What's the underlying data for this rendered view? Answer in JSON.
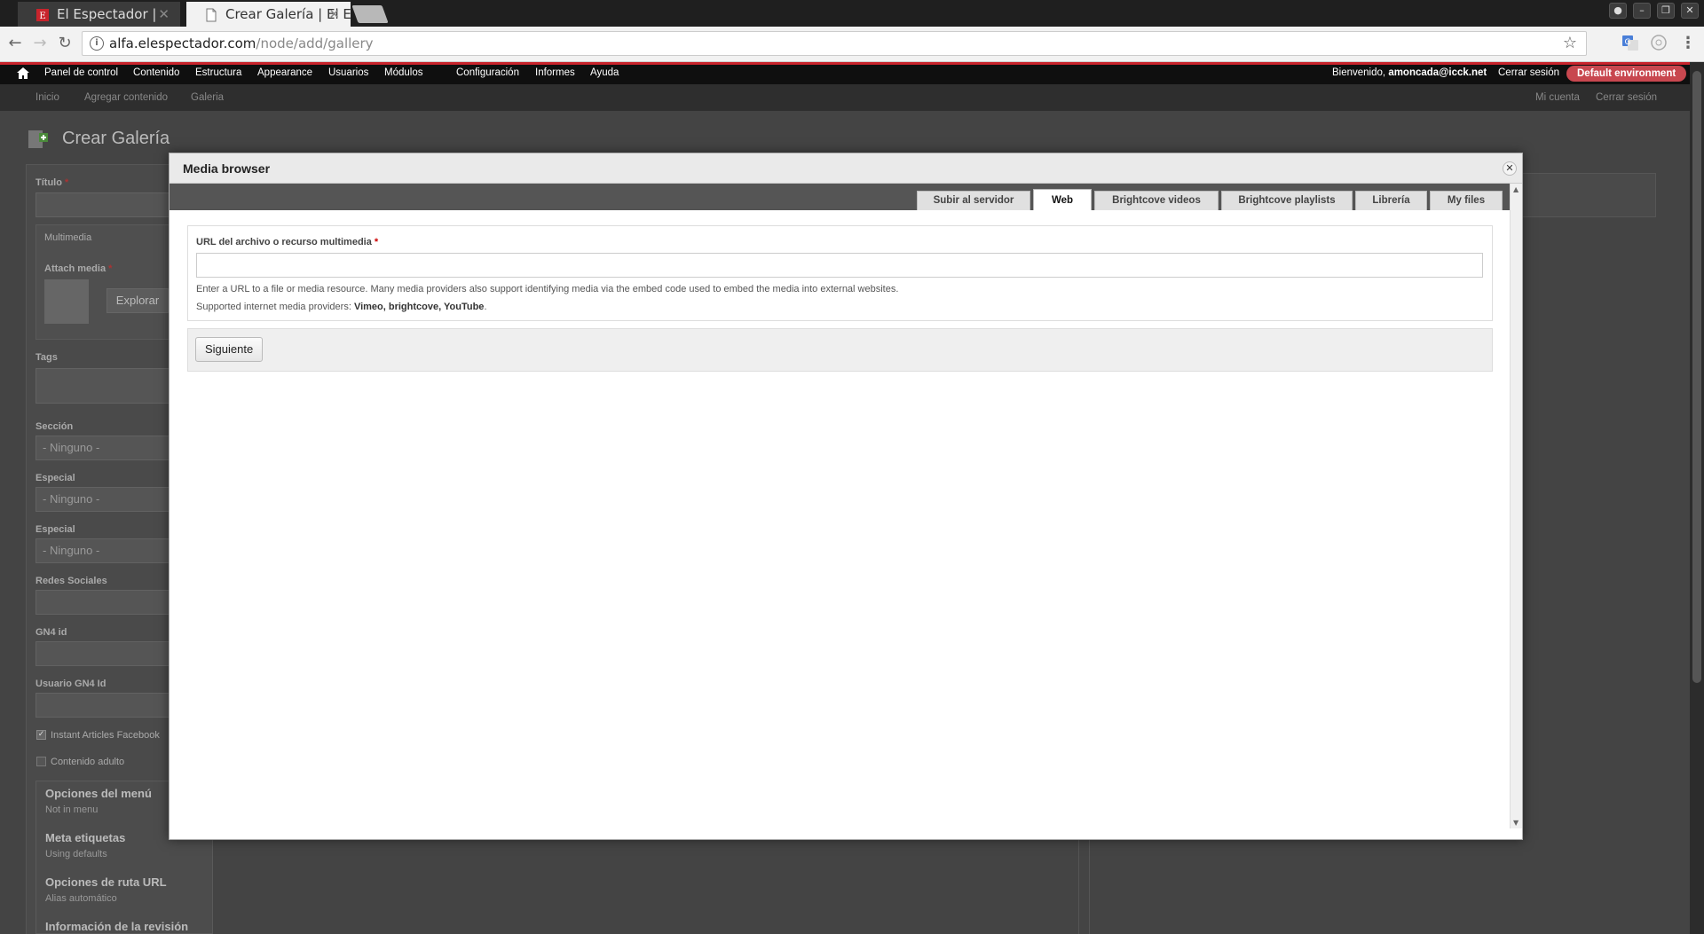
{
  "browser": {
    "tabs": [
      {
        "title": "El Espectador |",
        "active": false
      },
      {
        "title": "Crear Galería | El Es",
        "active": true
      }
    ],
    "url_host": "alfa.elespectador.com",
    "url_path": "/node/add/gallery"
  },
  "admin_toolbar": {
    "items": [
      "Panel de control",
      "Contenido",
      "Estructura",
      "Appearance",
      "Usuarios",
      "Módulos",
      "Configuración",
      "Informes",
      "Ayuda"
    ],
    "welcome_prefix": "Bienvenido,",
    "username": "amoncada@icck.net",
    "logout": "Cerrar sesión",
    "environment": "Default environment"
  },
  "shortcuts": {
    "left": [
      "Inicio",
      "Agregar contenido",
      "Galeria"
    ],
    "right": [
      "Mi cuenta",
      "Cerrar sesión"
    ]
  },
  "page": {
    "title": "Crear Galería",
    "form": {
      "title_label": "Título",
      "multimedia_label": "Multimedia",
      "attach_label": "Attach media",
      "browse_button": "Explorar",
      "tags_label": "Tags",
      "section_label": "Sección",
      "section_value": "- Ninguno -",
      "special1_label": "Especial",
      "special1_value": "- Ninguno -",
      "special2_label": "Especial",
      "special2_value": "- Ninguno -",
      "social_label": "Redes Sociales",
      "gn4_label": "GN4 id",
      "gn4_user_label": "Usuario GN4 Id",
      "instant_articles": "Instant Articles Facebook",
      "instant_articles_checked": true,
      "adult_content": "Contenido adulto",
      "adult_content_checked": false,
      "vertical_tabs": [
        {
          "title": "Opciones del menú",
          "summary": "Not in menu"
        },
        {
          "title": "Meta etiquetas",
          "summary": "Using defaults"
        },
        {
          "title": "Opciones de ruta URL",
          "summary": "Alias automático"
        },
        {
          "title": "Información de la revisión",
          "summary": ""
        }
      ]
    }
  },
  "media_browser": {
    "title": "Media browser",
    "tabs": [
      "Subir al servidor",
      "Web",
      "Brightcove videos",
      "Brightcove playlists",
      "Librería",
      "My files"
    ],
    "active_tab": "Web",
    "url_label": "URL del archivo o recurso multimedia",
    "url_value": "",
    "description": "Enter a URL to a file or media resource. Many media providers also support identifying media via the embed code used to embed the media into external websites.",
    "providers_prefix": "Supported internet media providers: ",
    "providers": "Vimeo, brightcove, YouTube",
    "providers_suffix": ".",
    "next_button": "Siguiente"
  }
}
